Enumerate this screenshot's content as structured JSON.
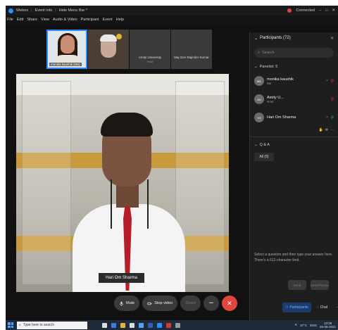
{
  "titlebar": {
    "app": "Webex",
    "event_info": "Event Info",
    "hide_menu": "Hide Menu Bar ^",
    "status": "Connected",
    "controls": [
      "–",
      "□",
      "✕"
    ]
  },
  "menu": [
    "File",
    "Edit",
    "Share",
    "View",
    "Audio & Video",
    "Participant",
    "Event",
    "Help"
  ],
  "thumbnails": [
    {
      "caption": "monika kaushik",
      "me": "(Me)",
      "active": true
    },
    {
      "caption": "",
      "active": false
    },
    {
      "name": "Amity University",
      "sub": "Host"
    },
    {
      "name": "Maj Gen Rajinder Kumar",
      "sub": ""
    }
  ],
  "main_video": {
    "label": "Hari Om Sharma"
  },
  "controls": {
    "mute": "Mute",
    "stop_video": "Stop video",
    "share": "Share",
    "more": "•••",
    "end": "✕"
  },
  "panel": {
    "title": "Participants (72)",
    "search_placeholder": "Search",
    "panelist_section": "Panelist: 5",
    "participants": [
      {
        "initials": "MK",
        "name": "monika kaushik",
        "role": "Me"
      },
      {
        "initials": "AU",
        "name": "Amity U...",
        "role": "Host"
      },
      {
        "initials": "HS",
        "name": "Hari Om Sharma",
        "role": ""
      }
    ],
    "qa_section": "Q & A",
    "qa_tab": "All (0)",
    "qa_hint": "Select a question and then type your answer here. There's a 512-character limit.",
    "qa_send": "Send",
    "qa_send_private": "Send Private",
    "bottom_participants": "Participants",
    "bottom_chat": "Chat"
  },
  "taskbar": {
    "search_placeholder": "Type here to search",
    "weather": "37°C",
    "lang": "ENG",
    "time": "13:39",
    "date": "26-06-2021"
  },
  "colors": {
    "accent": "#2d8cff",
    "end_call": "#e0463c",
    "tie": "#b51d2a"
  }
}
